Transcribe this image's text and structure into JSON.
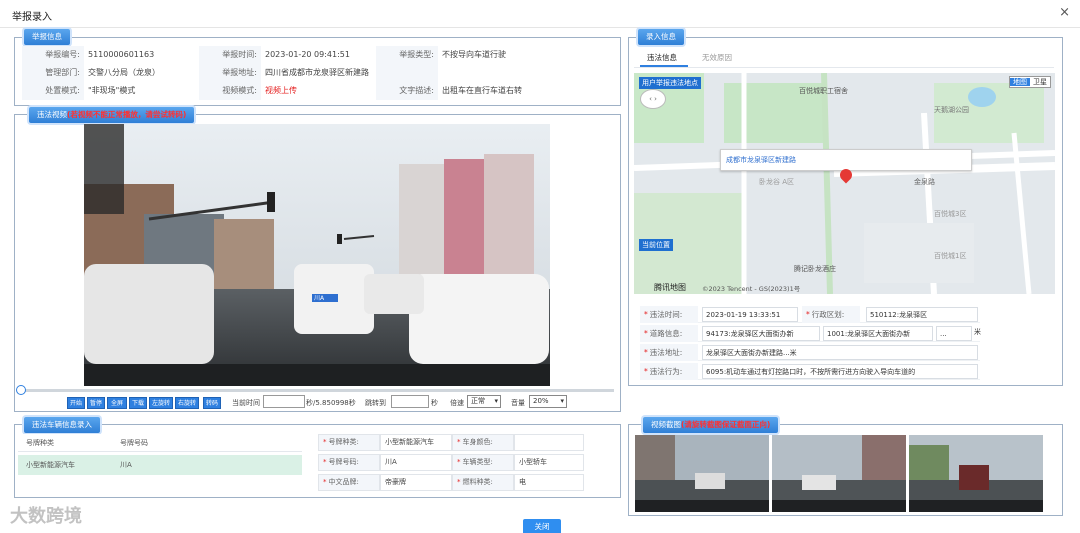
{
  "window": {
    "title": "举报录入",
    "close_glyph": "×"
  },
  "report": {
    "tag": "举报信息",
    "rows": [
      [
        {
          "label": "举报编号:",
          "value": "5110000601163"
        },
        {
          "label": "举报时间:",
          "value": "2023-01-20 09:41:51"
        },
        {
          "label": "举报类型:",
          "value": "不按导向车道行驶"
        }
      ],
      [
        {
          "label": "管理部门:",
          "value": "交警八分局（龙泉）"
        },
        {
          "label": "举报地址:",
          "value": "四川省成都市龙泉驿区新建路"
        },
        {
          "label": "",
          "value": ""
        }
      ],
      [
        {
          "label": "处置模式:",
          "value": "\"非现场\"模式"
        },
        {
          "label": "视频模式:",
          "value": "视频上传"
        },
        {
          "label": "文字描述:",
          "value": "出租车在直行车道右转"
        }
      ]
    ]
  },
  "video": {
    "tag": "违法视频",
    "warning": "(若视频不能正常播放，请尝试转码)",
    "controls": [
      "开始",
      "暂停",
      "全屏",
      "下载",
      "左旋转",
      "右旋转",
      "转码"
    ],
    "current_time_label": "当前时间",
    "duration_text": "秒/5.850998秒",
    "jump_label": "跳转到",
    "jump_unit": "秒",
    "speed_label": "倍速",
    "speed_value": "正常",
    "volume_label": "音量",
    "volume_value": "20%",
    "progress": 0.0,
    "plate_sign": "川A"
  },
  "entry": {
    "tag": "录入信息",
    "tabs": [
      "违法信息",
      "无效原因"
    ],
    "active_tab": 0,
    "map": {
      "user_point_label": "用户举报违法地点",
      "popup_address": "成都市龙泉驿区新建路",
      "current_pos_label": "当前位置",
      "map_tab": "地图",
      "satellite_tab": "卫星",
      "logo": "腾讯地图",
      "copyright": "©2023 Tencent - GS(2023)1号",
      "places": [
        "百悦城职工宿舍",
        "天鹅湖公园",
        "卧龙谷 A区",
        "金泉路",
        "百悦城3区",
        "百悦城1区",
        "腾记卧龙酒庄"
      ]
    },
    "fields": {
      "time_label": "违法时间:",
      "time_value": "2023-01-19 13:33:51",
      "district_label": "行政区划:",
      "district_value": "510112:龙泉驿区",
      "road_label": "道路信息:",
      "road_value": "94173:龙泉驿区大面街办新",
      "road_value2": "1001:龙泉驿区大面街办新",
      "road_extra": "...",
      "road_unit": "米",
      "addr_label": "违法地址:",
      "addr_value": "龙泉驿区大面街办新建路...米",
      "act_label": "违法行为:",
      "act_value": "6095:机动车通过有灯控路口时，不按所需行进方向驶入导向车道的"
    }
  },
  "plate": {
    "tag": "违法车辆信息录入",
    "headers": [
      "号牌种类",
      "号牌号码"
    ],
    "row": [
      "小型新能源汽车",
      "川A"
    ],
    "details": [
      [
        {
          "label": "号牌种类:",
          "value": "小型新能源汽车"
        },
        {
          "label": "车身颜色:",
          "value": ""
        }
      ],
      [
        {
          "label": "号牌号码:",
          "value": "川A"
        },
        {
          "label": "车辆类型:",
          "value": "小型轿车"
        }
      ],
      [
        {
          "label": "中文品牌:",
          "value": "帝豪牌"
        },
        {
          "label": "燃料种类:",
          "value": "电"
        }
      ]
    ]
  },
  "screenshots": {
    "tag": "视频截图",
    "warning": "(请旋转截图保证截面正向)"
  },
  "footer": {
    "close_label": "关闭",
    "watermark": "大数跨境"
  },
  "colors": {
    "accent": "#2f80e0",
    "warn": "#e52020",
    "selected_row": "#daf1e6"
  }
}
